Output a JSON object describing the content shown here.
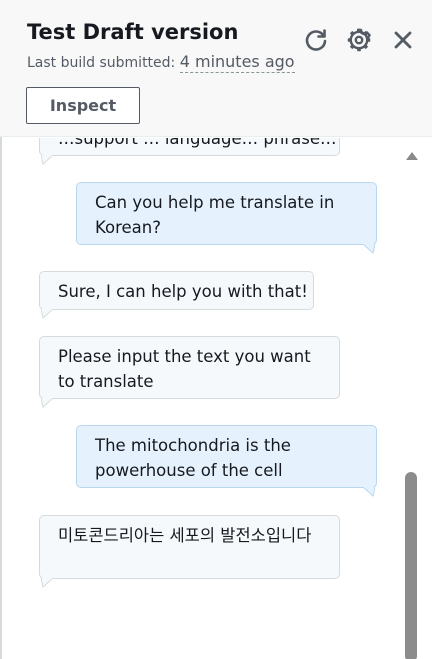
{
  "header": {
    "title": "Test Draft version",
    "subtitle_prefix": "Last build submitted:",
    "subtitle_time": "4 minutes ago",
    "inspect_label": "Inspect",
    "icons": [
      "refresh-icon",
      "settings-icon",
      "close-icon"
    ]
  },
  "messages": [
    {
      "from": "bot",
      "text": "…support … language… phrase…"
    },
    {
      "from": "user",
      "text": "Can you help me translate in Korean?"
    },
    {
      "from": "bot",
      "text": "Sure, I can help you with that!"
    },
    {
      "from": "bot",
      "text": "Please input the text you want to translate"
    },
    {
      "from": "user",
      "text": "The mitochondria is the powerhouse of the cell"
    },
    {
      "from": "bot",
      "text": "미토콘드리아는 세포의 발전소입니다"
    }
  ],
  "colors": {
    "bot_bubble": "#f6f9fc",
    "user_bubble": "#e5f2fd",
    "header_bg": "#f8f8f8",
    "scroll_thumb": "#8c8c8c"
  }
}
